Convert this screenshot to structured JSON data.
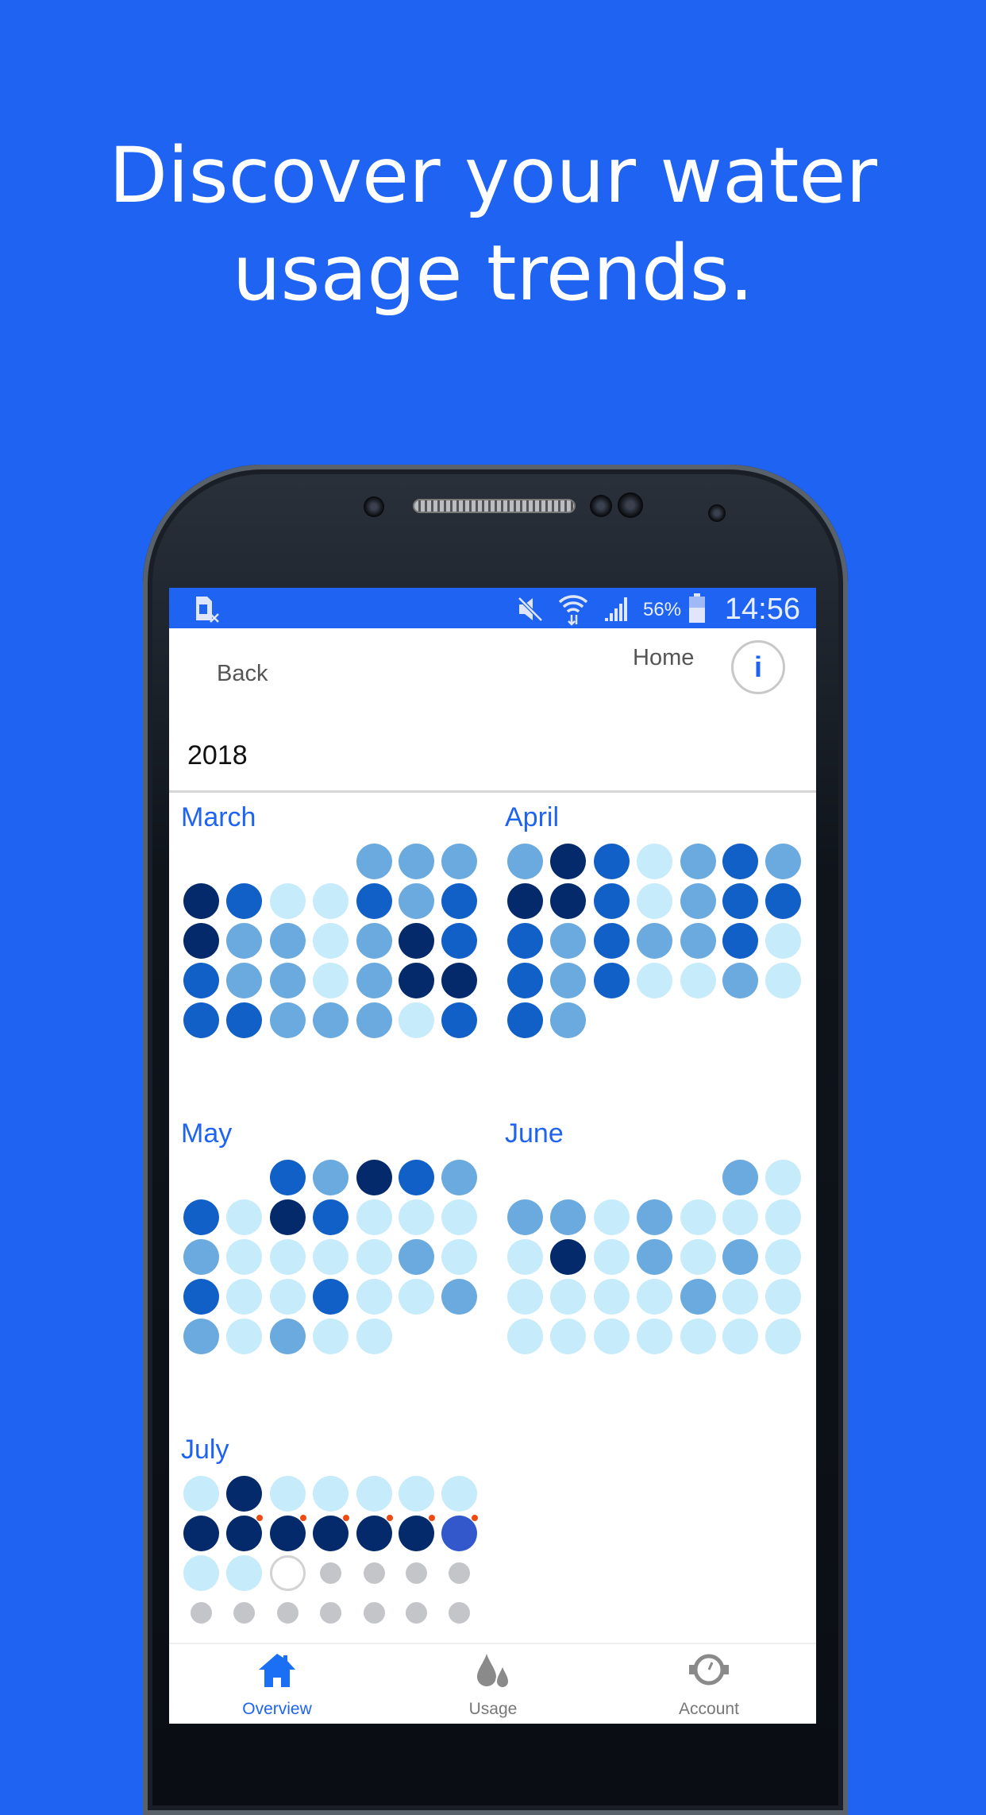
{
  "headline": {
    "line1": "Discover your water",
    "line2": "usage trends."
  },
  "status_bar": {
    "battery": "56%",
    "time": "14:56",
    "icons": [
      "sim-card-x-icon",
      "mute-icon",
      "wifi-icon",
      "signal-icon",
      "battery-icon"
    ]
  },
  "header": {
    "back_label": "Back",
    "home_label": "Home",
    "info_icon": "i"
  },
  "year": "2018",
  "colors": {
    "brand": "#1f63f3",
    "level0": "#c6ebfa",
    "level1": "#6aaadf",
    "level2": "#1160c8",
    "level3": "#052a6b",
    "current": "#3358cc",
    "future": "#c4c5c8",
    "alert": "#f04a14"
  },
  "months": [
    {
      "name": "March",
      "offset": 4,
      "levels": [
        1,
        1,
        1,
        3,
        2,
        0,
        0,
        2,
        1,
        2,
        3,
        1,
        1,
        0,
        1,
        3,
        2,
        2,
        1,
        1,
        0,
        1,
        3,
        3,
        2,
        2,
        1,
        1,
        1,
        0,
        2
      ]
    },
    {
      "name": "April",
      "offset": 0,
      "levels": [
        1,
        3,
        2,
        0,
        1,
        2,
        1,
        3,
        3,
        2,
        0,
        1,
        2,
        2,
        2,
        1,
        2,
        1,
        1,
        2,
        0,
        2,
        1,
        2,
        0,
        0,
        1,
        0,
        2,
        1
      ]
    },
    {
      "name": "May",
      "offset": 2,
      "levels": [
        2,
        1,
        3,
        2,
        1,
        2,
        0,
        3,
        2,
        0,
        0,
        0,
        1,
        0,
        0,
        0,
        0,
        1,
        0,
        2,
        0,
        0,
        2,
        0,
        0,
        1,
        1,
        0,
        1,
        0,
        0
      ]
    },
    {
      "name": "June",
      "offset": 5,
      "levels": [
        1,
        0,
        1,
        1,
        0,
        1,
        0,
        0,
        0,
        0,
        3,
        0,
        1,
        0,
        1,
        0,
        0,
        0,
        0,
        0,
        1,
        0,
        0,
        0,
        0,
        0,
        0,
        0,
        0,
        0
      ]
    },
    {
      "name": "July",
      "offset": 0,
      "levels": [
        0,
        3,
        0,
        0,
        0,
        0,
        0,
        3,
        "3a",
        "3a",
        "3a",
        "3a",
        "3a",
        "ca",
        0,
        0,
        "t",
        "f",
        "f",
        "f",
        "f",
        "f",
        "f",
        "f",
        "f",
        "f",
        "f",
        "f"
      ]
    }
  ],
  "nav": [
    {
      "label": "Overview",
      "icon": "home-icon",
      "active": true
    },
    {
      "label": "Usage",
      "icon": "water-drops-icon",
      "active": false
    },
    {
      "label": "Account",
      "icon": "meter-gauge-icon",
      "active": false
    }
  ]
}
